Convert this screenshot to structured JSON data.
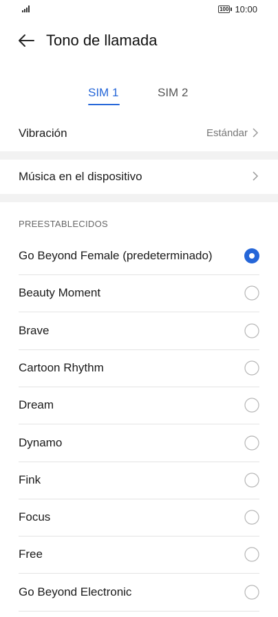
{
  "status": {
    "battery": "100",
    "time": "10:00"
  },
  "header": {
    "title": "Tono de llamada",
    "back_icon": "arrow-left-icon"
  },
  "tabs": [
    {
      "label": "SIM 1",
      "active": true
    },
    {
      "label": "SIM 2",
      "active": false
    }
  ],
  "settings": {
    "vibration": {
      "label": "Vibración",
      "value": "Estándar"
    },
    "device_music": {
      "label": "Música en el dispositivo"
    }
  },
  "presets": {
    "header": "PREESTABLECIDOS",
    "items": [
      {
        "label": "Go Beyond Female (predeterminado)",
        "selected": true
      },
      {
        "label": "Beauty Moment",
        "selected": false
      },
      {
        "label": "Brave",
        "selected": false
      },
      {
        "label": "Cartoon Rhythm",
        "selected": false
      },
      {
        "label": "Dream",
        "selected": false
      },
      {
        "label": "Dynamo",
        "selected": false
      },
      {
        "label": "Fink",
        "selected": false
      },
      {
        "label": "Focus",
        "selected": false
      },
      {
        "label": "Free",
        "selected": false
      },
      {
        "label": "Go Beyond Electronic",
        "selected": false
      }
    ]
  },
  "colors": {
    "accent": "#2566d8",
    "divider": "#f2f2f2",
    "separator": "#e3e3e3"
  }
}
